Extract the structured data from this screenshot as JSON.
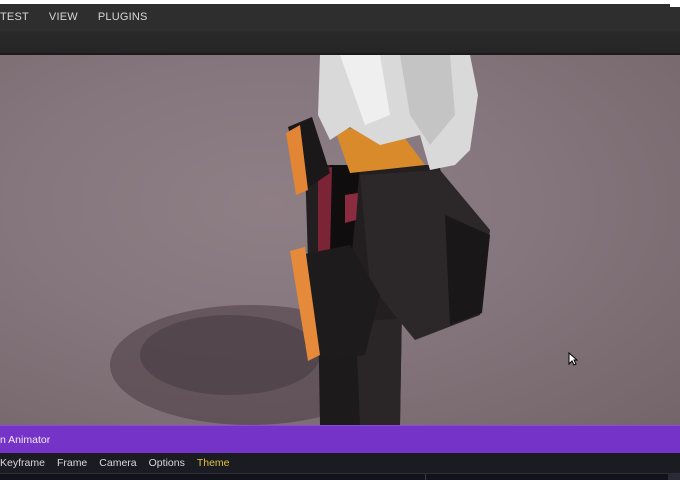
{
  "menubar": {
    "items": [
      "TEST",
      "VIEW",
      "PLUGINS"
    ]
  },
  "plugin": {
    "title": "n Animator",
    "menu": [
      "Keyframe",
      "Frame",
      "Camera",
      "Options",
      "Theme"
    ],
    "active_menu": "Theme"
  },
  "colors": {
    "menubar_bg": "#2e2e2e",
    "plugin_accent": "#7633c7",
    "active_menu_text": "#e0c245",
    "viewport_bg": "#85767d"
  }
}
